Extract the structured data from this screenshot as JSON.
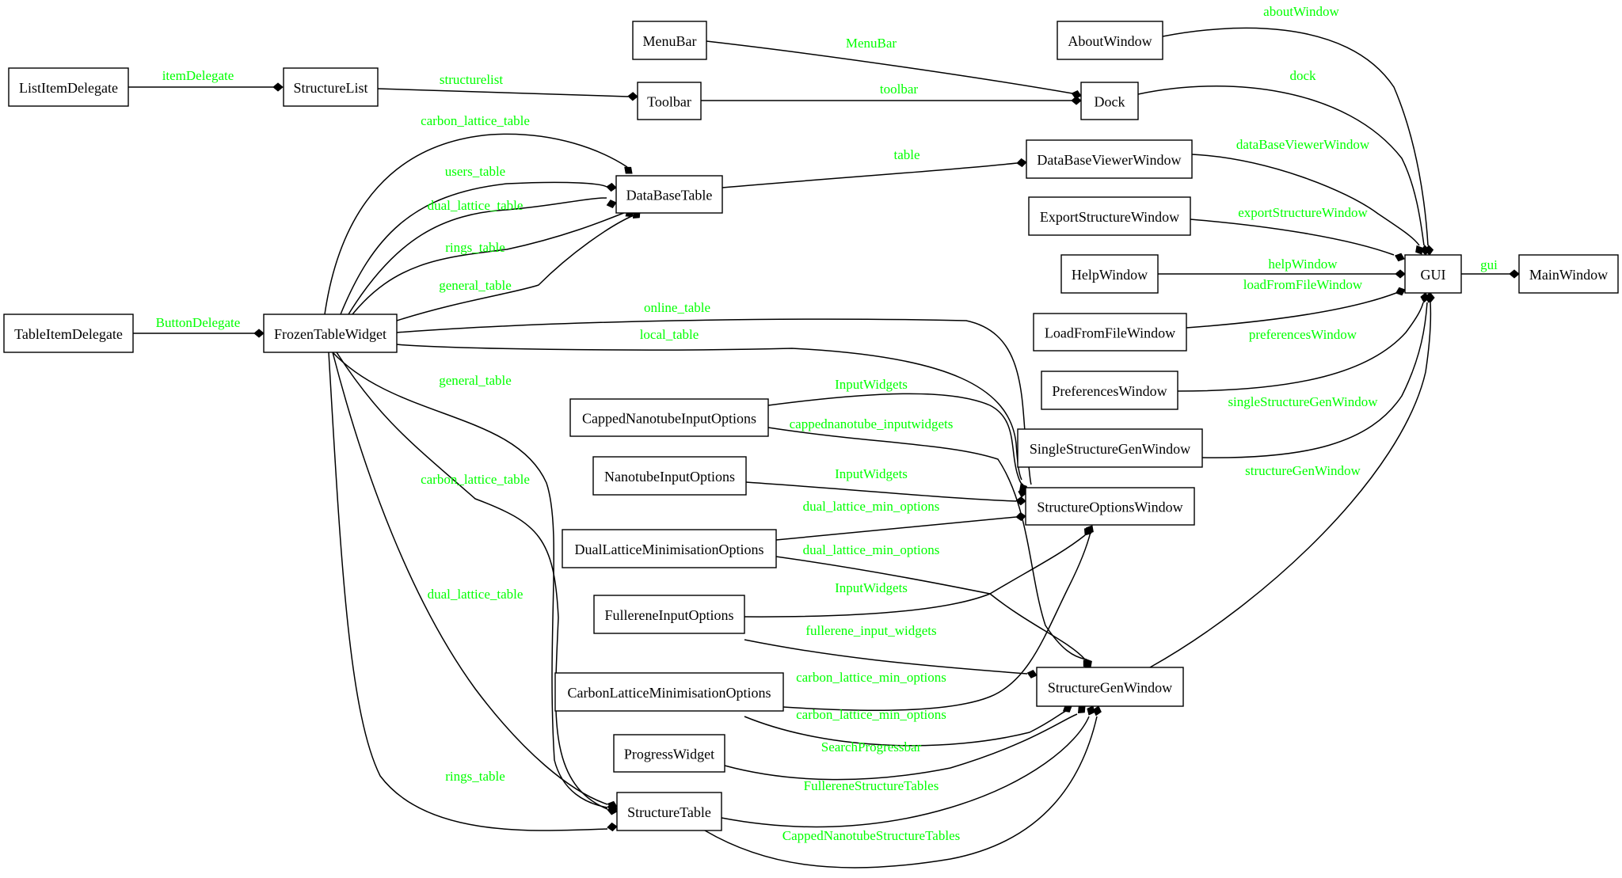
{
  "diagram": {
    "type": "class-composition-graph",
    "edge_label_color": "#00ff00",
    "node_border_color": "#000000",
    "arrowhead": "filled-diamond",
    "nodes": [
      {
        "id": "ListItemDelegate",
        "label": "ListItemDelegate"
      },
      {
        "id": "StructureList",
        "label": "StructureList"
      },
      {
        "id": "MenuBar",
        "label": "MenuBar"
      },
      {
        "id": "Toolbar",
        "label": "Toolbar"
      },
      {
        "id": "AboutWindow",
        "label": "AboutWindow"
      },
      {
        "id": "Dock",
        "label": "Dock"
      },
      {
        "id": "DataBaseTable",
        "label": "DataBaseTable"
      },
      {
        "id": "DataBaseViewerWindow",
        "label": "DataBaseViewerWindow"
      },
      {
        "id": "ExportStructureWindow",
        "label": "ExportStructureWindow"
      },
      {
        "id": "HelpWindow",
        "label": "HelpWindow"
      },
      {
        "id": "GUI",
        "label": "GUI"
      },
      {
        "id": "MainWindow",
        "label": "MainWindow"
      },
      {
        "id": "LoadFromFileWindow",
        "label": "LoadFromFileWindow"
      },
      {
        "id": "PreferencesWindow",
        "label": "PreferencesWindow"
      },
      {
        "id": "SingleStructureGenWindow",
        "label": "SingleStructureGenWindow"
      },
      {
        "id": "TableItemDelegate",
        "label": "TableItemDelegate"
      },
      {
        "id": "FrozenTableWidget",
        "label": "FrozenTableWidget"
      },
      {
        "id": "CappedNanotubeInputOptions",
        "label": "CappedNanotubeInputOptions"
      },
      {
        "id": "NanotubeInputOptions",
        "label": "NanotubeInputOptions"
      },
      {
        "id": "StructureOptionsWindow",
        "label": "StructureOptionsWindow"
      },
      {
        "id": "DualLatticeMinimisationOptions",
        "label": "DualLatticeMinimisationOptions"
      },
      {
        "id": "FullereneInputOptions",
        "label": "FullereneInputOptions"
      },
      {
        "id": "StructureGenWindow",
        "label": "StructureGenWindow"
      },
      {
        "id": "CarbonLatticeMinimisationOptions",
        "label": "CarbonLatticeMinimisationOptions"
      },
      {
        "id": "ProgressWidget",
        "label": "ProgressWidget"
      },
      {
        "id": "StructureTable",
        "label": "StructureTable"
      }
    ],
    "edges": [
      {
        "from": "ListItemDelegate",
        "to": "StructureList",
        "label": "itemDelegate"
      },
      {
        "from": "StructureList",
        "to": "Toolbar",
        "label": "structurelist"
      },
      {
        "from": "MenuBar",
        "to": "Dock",
        "label": "MenuBar"
      },
      {
        "from": "Toolbar",
        "to": "Dock",
        "label": "toolbar"
      },
      {
        "from": "AboutWindow",
        "to": "GUI",
        "label": "aboutWindow"
      },
      {
        "from": "Dock",
        "to": "GUI",
        "label": "dock"
      },
      {
        "from": "DataBaseTable",
        "to": "DataBaseViewerWindow",
        "label": "table"
      },
      {
        "from": "DataBaseViewerWindow",
        "to": "GUI",
        "label": "dataBaseViewerWindow"
      },
      {
        "from": "ExportStructureWindow",
        "to": "GUI",
        "label": "exportStructureWindow"
      },
      {
        "from": "HelpWindow",
        "to": "GUI",
        "label": "helpWindow"
      },
      {
        "from": "LoadFromFileWindow",
        "to": "GUI",
        "label": "loadFromFileWindow"
      },
      {
        "from": "PreferencesWindow",
        "to": "GUI",
        "label": "preferencesWindow"
      },
      {
        "from": "SingleStructureGenWindow",
        "to": "GUI",
        "label": "singleStructureGenWindow"
      },
      {
        "from": "StructureGenWindow",
        "to": "GUI",
        "label": "structureGenWindow"
      },
      {
        "from": "GUI",
        "to": "MainWindow",
        "label": "gui"
      },
      {
        "from": "TableItemDelegate",
        "to": "FrozenTableWidget",
        "label": "ButtonDelegate"
      },
      {
        "from": "FrozenTableWidget",
        "to": "DataBaseTable",
        "label": "carbon_lattice_table"
      },
      {
        "from": "FrozenTableWidget",
        "to": "DataBaseTable",
        "label": "users_table"
      },
      {
        "from": "FrozenTableWidget",
        "to": "DataBaseTable",
        "label": "dual_lattice_table"
      },
      {
        "from": "FrozenTableWidget",
        "to": "DataBaseTable",
        "label": "rings_table"
      },
      {
        "from": "FrozenTableWidget",
        "to": "DataBaseTable",
        "label": "general_table"
      },
      {
        "from": "FrozenTableWidget",
        "to": "StructureOptionsWindow",
        "label": "online_table"
      },
      {
        "from": "FrozenTableWidget",
        "to": "StructureOptionsWindow",
        "label": "local_table"
      },
      {
        "from": "FrozenTableWidget",
        "to": "StructureTable",
        "label": "general_table"
      },
      {
        "from": "FrozenTableWidget",
        "to": "StructureTable",
        "label": "carbon_lattice_table"
      },
      {
        "from": "FrozenTableWidget",
        "to": "StructureTable",
        "label": "dual_lattice_table"
      },
      {
        "from": "FrozenTableWidget",
        "to": "StructureTable",
        "label": "rings_table"
      },
      {
        "from": "CappedNanotubeInputOptions",
        "to": "StructureOptionsWindow",
        "label": "InputWidgets"
      },
      {
        "from": "CappedNanotubeInputOptions",
        "to": "StructureGenWindow",
        "label": "cappednanotube_inputwidgets"
      },
      {
        "from": "NanotubeInputOptions",
        "to": "StructureOptionsWindow",
        "label": "InputWidgets"
      },
      {
        "from": "DualLatticeMinimisationOptions",
        "to": "StructureOptionsWindow",
        "label": "dual_lattice_min_options"
      },
      {
        "from": "DualLatticeMinimisationOptions",
        "to": "StructureGenWindow",
        "label": "dual_lattice_min_options"
      },
      {
        "from": "FullereneInputOptions",
        "to": "StructureOptionsWindow",
        "label": "InputWidgets"
      },
      {
        "from": "FullereneInputOptions",
        "to": "StructureGenWindow",
        "label": "fullerene_input_widgets"
      },
      {
        "from": "CarbonLatticeMinimisationOptions",
        "to": "StructureOptionsWindow",
        "label": "carbon_lattice_min_options"
      },
      {
        "from": "CarbonLatticeMinimisationOptions",
        "to": "StructureGenWindow",
        "label": "carbon_lattice_min_options"
      },
      {
        "from": "ProgressWidget",
        "to": "StructureGenWindow",
        "label": "SearchProgressbar"
      },
      {
        "from": "StructureTable",
        "to": "StructureGenWindow",
        "label": "FullereneStructureTables"
      },
      {
        "from": "StructureTable",
        "to": "StructureGenWindow",
        "label": "CappedNanotubeStructureTables"
      }
    ]
  }
}
